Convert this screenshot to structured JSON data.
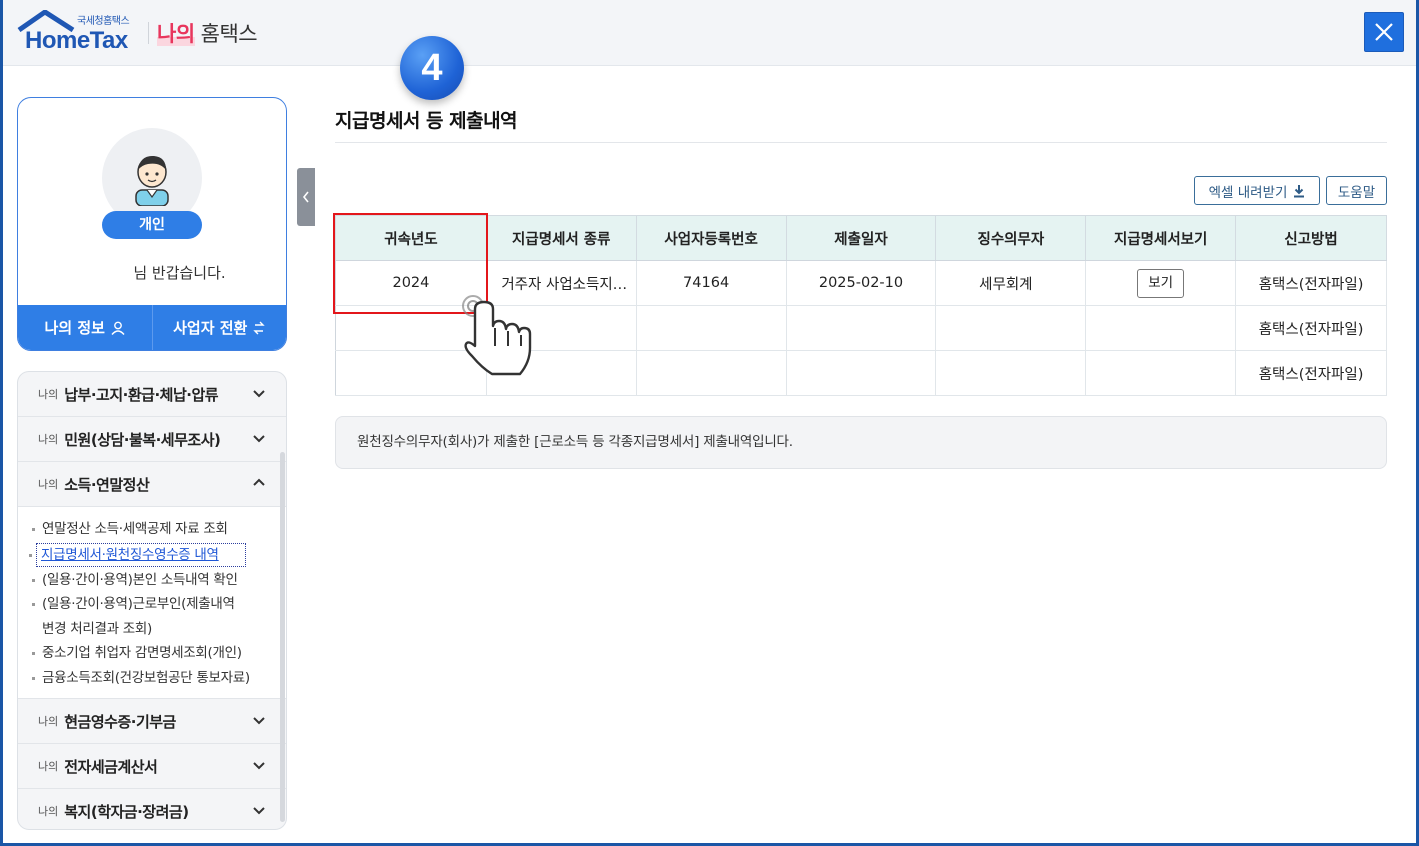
{
  "header": {
    "logo_sub": "국세청홈택스",
    "logo_main": "HomeTax",
    "my_label": "나의",
    "hometax_label": "홈택스"
  },
  "step_number": "4",
  "profile": {
    "type_badge": "개인",
    "greeting": "님 반갑습니다.",
    "my_info_button": "나의 정보",
    "switch_button": "사업자 전환"
  },
  "menu": {
    "prefix": "나의",
    "items": [
      {
        "label": "납부·고지·환급·체납·압류"
      },
      {
        "label": "민원(상담·불복·세무조사)"
      },
      {
        "label": "소득·연말정산"
      },
      {
        "label": "현금영수증·기부금"
      },
      {
        "label": "전자세금계산서"
      },
      {
        "label": "복지(학자금·장려금)"
      }
    ],
    "submenu": [
      "연말정산 소득·세액공제 자료 조회",
      "지급명세서·원천징수영수증 내역",
      "(일용·간이·용역)본인 소득내역 확인",
      "(일용·간이·용역)근로부인(제출내역",
      "변경 처리결과 조회)",
      "중소기업 취업자 감면명세조회(개인)",
      "금융소득조회(건강보험공단 통보자료)"
    ]
  },
  "main": {
    "title": "지급명세서 등 제출내역",
    "excel_button": "엑셀 내려받기",
    "help_button": "도움말",
    "columns": [
      "귀속년도",
      "지급명세서 종류",
      "사업자등록번호",
      "제출일자",
      "징수의무자",
      "지급명세서보기",
      "신고방법"
    ],
    "rows": [
      {
        "year": "2024",
        "kind": "거주자 사업소득지…",
        "bizno": "74164",
        "date": "2025-02-10",
        "payer": "세무회계",
        "view": "보기",
        "method": "홈택스(전자파일)"
      },
      {
        "method": "홈택스(전자파일)"
      },
      {
        "method": "홈택스(전자파일)"
      }
    ],
    "info": "원천징수의무자(회사)가 제출한 [근로소득 등 각종지급명세서] 제출내역입니다."
  },
  "colors": {
    "brand_blue": "#1f57b4",
    "accent_blue": "#2f7ee6",
    "highlight_red": "#e3161b",
    "table_header_bg": "#e5f3f2"
  }
}
